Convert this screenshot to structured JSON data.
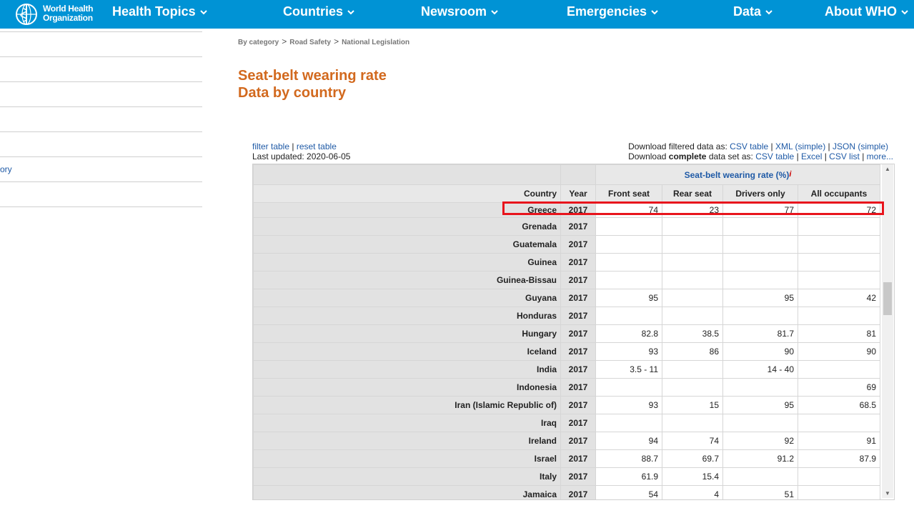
{
  "org": {
    "line1": "World Health",
    "line2": "Organization"
  },
  "nav": [
    "Health Topics",
    "Countries",
    "Newsroom",
    "Emergencies",
    "Data",
    "About WHO"
  ],
  "sidebar": [
    "",
    "",
    "",
    "",
    "",
    "ory",
    ""
  ],
  "breadcrumb": [
    "By category",
    "Road Safety",
    "National Legislation"
  ],
  "title": {
    "line1": "Seat-belt wearing rate",
    "line2": "Data by country"
  },
  "toolbar": {
    "filter": "filter table",
    "reset": "reset table",
    "sep": " | ",
    "last_updated": "Last updated: 2020-06-05",
    "dl_filtered": "Download filtered data as:",
    "csv_table": "CSV table",
    "xml": "XML (simple)",
    "json": "JSON (simple)",
    "dl_complete_pre": "Download",
    "dl_complete_bold": "complete",
    "dl_complete_post": "data set as:",
    "csv_table2": "CSV table",
    "excel": "Excel",
    "csv_list": "CSV list",
    "more": "more..."
  },
  "table": {
    "group_header": "Seat-belt wearing rate (%)",
    "info_mark": "i",
    "columns": [
      "Country",
      "Year",
      "Front seat",
      "Rear seat",
      "Drivers only",
      "All occupants"
    ],
    "rows": [
      [
        "Greece",
        "2017",
        "74",
        "23",
        "77",
        "72"
      ],
      [
        "Grenada",
        "2017",
        "",
        "",
        "",
        ""
      ],
      [
        "Guatemala",
        "2017",
        "",
        "",
        "",
        ""
      ],
      [
        "Guinea",
        "2017",
        "",
        "",
        "",
        ""
      ],
      [
        "Guinea-Bissau",
        "2017",
        "",
        "",
        "",
        ""
      ],
      [
        "Guyana",
        "2017",
        "95",
        "",
        "95",
        "42"
      ],
      [
        "Honduras",
        "2017",
        "",
        "",
        "",
        ""
      ],
      [
        "Hungary",
        "2017",
        "82.8",
        "38.5",
        "81.7",
        "81"
      ],
      [
        "Iceland",
        "2017",
        "93",
        "86",
        "90",
        "90"
      ],
      [
        "India",
        "2017",
        "3.5 - 11",
        "",
        "14 - 40",
        ""
      ],
      [
        "Indonesia",
        "2017",
        "",
        "",
        "",
        "69"
      ],
      [
        "Iran (Islamic Republic of)",
        "2017",
        "93",
        "15",
        "95",
        "68.5"
      ],
      [
        "Iraq",
        "2017",
        "",
        "",
        "",
        ""
      ],
      [
        "Ireland",
        "2017",
        "94",
        "74",
        "92",
        "91"
      ],
      [
        "Israel",
        "2017",
        "88.7",
        "69.7",
        "91.2",
        "87.9"
      ],
      [
        "Italy",
        "2017",
        "61.9",
        "15.4",
        "",
        ""
      ],
      [
        "Jamaica",
        "2017",
        "54",
        "4",
        "51",
        ""
      ]
    ]
  },
  "colors": {
    "nav_bg": "#0093d5",
    "title": "#d2691e",
    "link": "#1f5aa6",
    "highlight": "#e8141c"
  }
}
